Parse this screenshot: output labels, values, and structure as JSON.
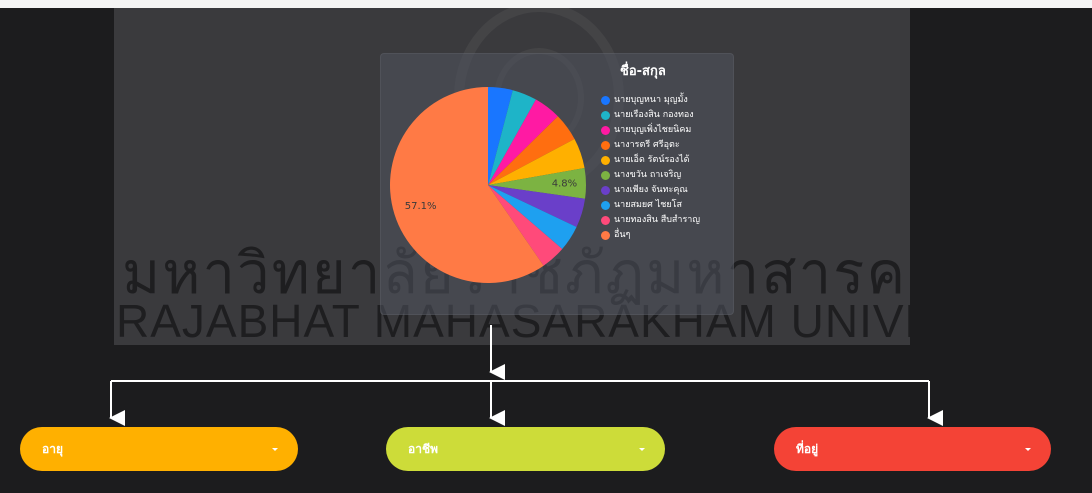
{
  "banner": {
    "watermark_thai": "มหาวิทยาลัยราชภัฏมหาสารคาม",
    "watermark_english": "RAJABHAT MAHASARAKHAM UNIVERSITY"
  },
  "chart_data": {
    "type": "pie",
    "title": "ชื่อ-สกุล",
    "legend_position": "right",
    "series": [
      {
        "label": "นายบุญหนา มุญมั้ง",
        "value": 3.9,
        "color": "#1976ff"
      },
      {
        "label": "นายเรืองสิน กองทอง",
        "value": 3.9,
        "color": "#1eb4c8"
      },
      {
        "label": "นายบุญเพิ่งไชยนิคม",
        "value": 4.3,
        "color": "#ff1aa3"
      },
      {
        "label": "นางารตรี ศรีอุตะ",
        "value": 4.4,
        "color": "#ff6e10"
      },
      {
        "label": "นายเอ็ด รัตน์รองได้",
        "value": 4.8,
        "color": "#ffb000"
      },
      {
        "label": "นางขวัน ถาเจริญ",
        "value": 4.8,
        "color": "#7cb342",
        "show_label": "4.8%"
      },
      {
        "label": "นางเพียง จันทะคุณ",
        "value": 4.6,
        "color": "#6a3fc9"
      },
      {
        "label": "นายสมยศ ไชยโส",
        "value": 4.1,
        "color": "#1ea0f0"
      },
      {
        "label": "นายทองสิน สืบสำราญ",
        "value": 3.9,
        "color": "#ff4a7a"
      },
      {
        "label": "อื่นๆ",
        "value": 57.1,
        "color": "#ff7a45",
        "show_label": "57.1%"
      }
    ]
  },
  "dropdowns": {
    "age": {
      "label": "อายุ",
      "color": "#ffb000"
    },
    "occupation": {
      "label": "อาชีพ",
      "color": "#cddc39"
    },
    "address": {
      "label": "ที่อยู่",
      "color": "#f44336"
    }
  }
}
